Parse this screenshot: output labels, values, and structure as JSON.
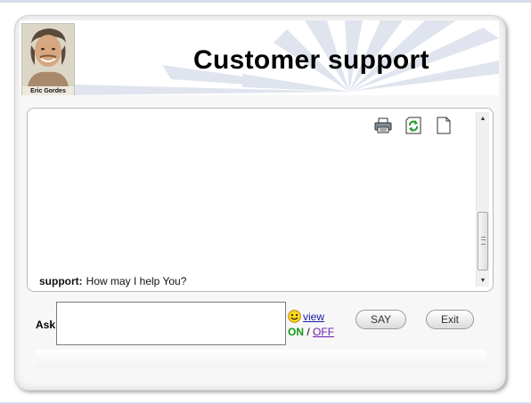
{
  "header": {
    "title": "Customer support",
    "agent_name": "Eric Gordes"
  },
  "chat": {
    "messages": [
      {
        "speaker": "support:",
        "text": "How may I help You?"
      }
    ],
    "toolbar": {
      "print_icon": "printer-icon",
      "refresh_icon": "refresh-icon",
      "new_icon": "new-document-icon"
    }
  },
  "input": {
    "ask_label": "Ask",
    "value": "",
    "smiley_link": "view",
    "on_label": "ON",
    "separator": "/",
    "off_label": "OFF"
  },
  "buttons": {
    "say": "SAY",
    "exit": "Exit"
  },
  "colors": {
    "on_green": "#1a9a1a",
    "link_blue": "#1a1aa6",
    "off_purple": "#6a1ab0"
  }
}
